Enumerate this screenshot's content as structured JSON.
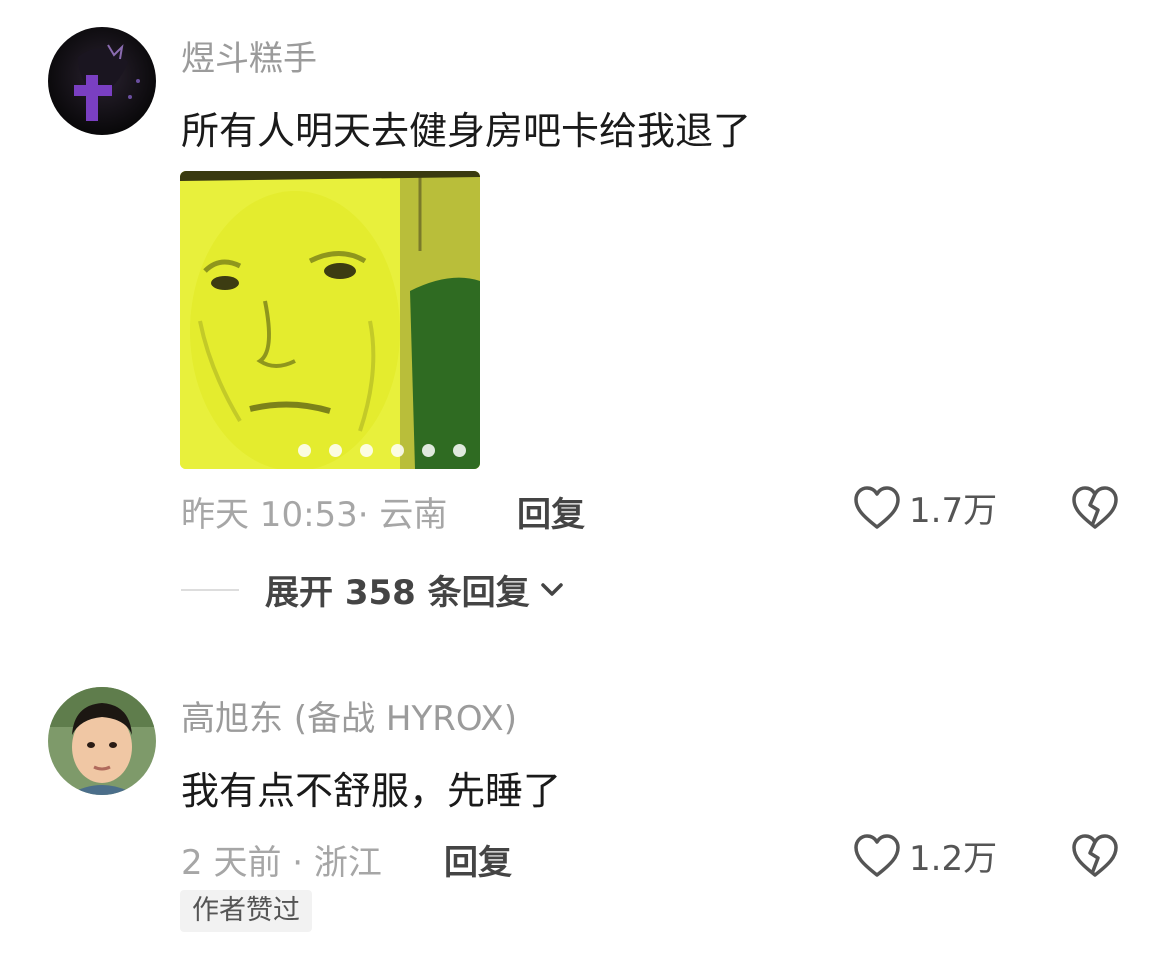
{
  "comments": [
    {
      "username": "煜斗糕手",
      "text": "所有人明天去健身房吧卡给我退了",
      "meta": "昨天 10:53· 云南",
      "reply_label": "回复",
      "like_count": "1.7万",
      "image_page_count": 6,
      "expand_label": "展开 358 条回复"
    },
    {
      "username": "高旭东 (备战 HYROX)",
      "text": "我有点不舒服，先睡了",
      "meta": "2 天前 · 浙江",
      "reply_label": "回复",
      "like_count": "1.2万",
      "badge": "作者赞过"
    }
  ],
  "icons": {
    "like": "heart-outline-icon",
    "dislike": "broken-heart-icon",
    "expand": "chevron-down-icon"
  }
}
